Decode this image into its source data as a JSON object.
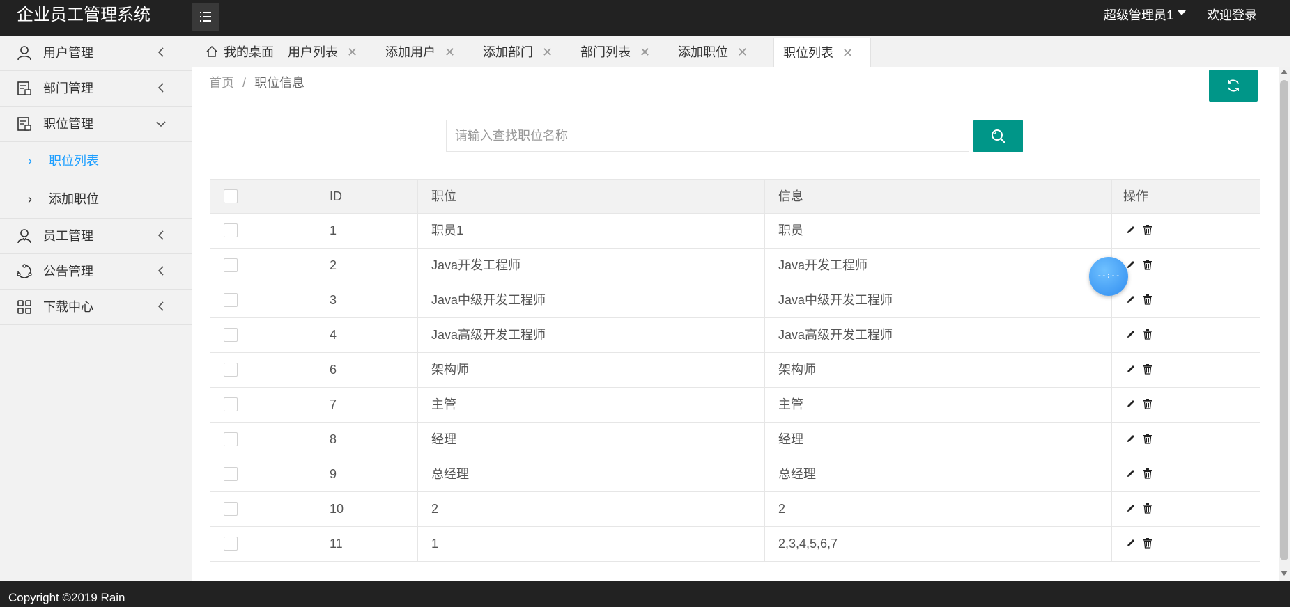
{
  "header": {
    "title": "企业员工管理系统",
    "admin": "超级管理员1",
    "welcome": "欢迎登录"
  },
  "sidebar": {
    "items": [
      {
        "label": "用户管理",
        "icon": "user-icon"
      },
      {
        "label": "部门管理",
        "icon": "department-icon"
      },
      {
        "label": "职位管理",
        "icon": "position-icon",
        "expanded": true
      },
      {
        "label": "员工管理",
        "icon": "employee-icon"
      },
      {
        "label": "公告管理",
        "icon": "announcement-icon"
      },
      {
        "label": "下载中心",
        "icon": "grid-icon"
      }
    ],
    "subitems": [
      {
        "label": "职位列表",
        "active": true
      },
      {
        "label": "添加职位",
        "active": false
      }
    ]
  },
  "tabs": [
    {
      "label": "我的桌面",
      "closable": false
    },
    {
      "label": "用户列表",
      "closable": true
    },
    {
      "label": "添加用户",
      "closable": true
    },
    {
      "label": "添加部门",
      "closable": true
    },
    {
      "label": "部门列表",
      "closable": true
    },
    {
      "label": "添加职位",
      "closable": true
    },
    {
      "label": "职位列表",
      "closable": true,
      "active": true
    }
  ],
  "breadcrumb": {
    "home": "首页",
    "sep": "/",
    "current": "职位信息"
  },
  "search": {
    "placeholder": "请输入查找职位名称",
    "value": ""
  },
  "table": {
    "headers": [
      "ID",
      "职位",
      "信息",
      "操作"
    ],
    "rows": [
      {
        "id": "1",
        "name": "职员1",
        "info": "职员"
      },
      {
        "id": "2",
        "name": "Java开发工程师",
        "info": "Java开发工程师"
      },
      {
        "id": "3",
        "name": "Java中级开发工程师",
        "info": "Java中级开发工程师"
      },
      {
        "id": "4",
        "name": "Java高级开发工程师",
        "info": "Java高级开发工程师"
      },
      {
        "id": "6",
        "name": "架构师",
        "info": "架构师"
      },
      {
        "id": "7",
        "name": "主管",
        "info": "主管"
      },
      {
        "id": "8",
        "name": "经理",
        "info": "经理"
      },
      {
        "id": "9",
        "name": "总经理",
        "info": "总经理"
      },
      {
        "id": "10",
        "name": "2",
        "info": "2"
      },
      {
        "id": "11",
        "name": "1",
        "info": "2,3,4,5,6,7"
      }
    ]
  },
  "floating_widget": {
    "text": "--:--"
  },
  "footer": {
    "copyright": "Copyright ©2019 Rain"
  },
  "colors": {
    "header_bg": "#222222",
    "accent": "#009688",
    "active_link": "#1E9FFF",
    "float_ball": "#2f8cf0"
  }
}
